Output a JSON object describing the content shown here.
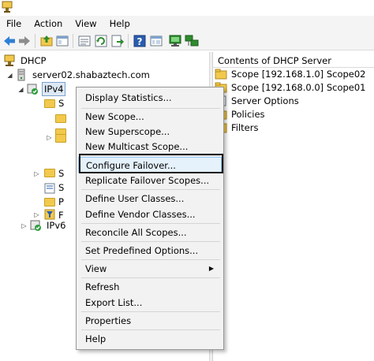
{
  "menubar": {
    "items": [
      "File",
      "Action",
      "View",
      "Help"
    ]
  },
  "toolbar": {
    "buttons": [
      "back-arrow-icon",
      "forward-arrow-icon",
      "up-folder-icon",
      "show-hide-tree-icon",
      "properties-icon",
      "refresh-icon",
      "export-icon",
      "help-icon",
      "view-icon",
      "monitor-icon",
      "network-icon"
    ]
  },
  "tree": {
    "root": "DHCP",
    "server": "server02.shabaztech.com",
    "ipv4": "IPv4",
    "ipv6": "IPv6",
    "partial_s1": "S",
    "partial_s2": "S",
    "partial_s3": "S",
    "partial_p1": "P",
    "partial_f1": "F"
  },
  "right_pane": {
    "header": "Contents of DHCP Server",
    "items": [
      "Scope [192.168.1.0] Scope02",
      "Scope [192.168.0.0] Scope01",
      "Server Options",
      "Policies",
      "Filters"
    ]
  },
  "context_menu": {
    "display_statistics": "Display Statistics...",
    "new_scope": "New Scope...",
    "new_superscope": "New Superscope...",
    "new_multicast_scope": "New Multicast Scope...",
    "configure_failover": "Configure Failover...",
    "replicate_failover_scopes": "Replicate Failover Scopes...",
    "define_user_classes": "Define User Classes...",
    "define_vendor_classes": "Define Vendor Classes...",
    "reconcile_all_scopes": "Reconcile All Scopes...",
    "set_predefined_options": "Set Predefined Options...",
    "view": "View",
    "refresh": "Refresh",
    "export_list": "Export List...",
    "properties": "Properties",
    "help": "Help"
  },
  "colors": {
    "menu_bg": "#f2f2f2",
    "highlight_bg": "#e5f1fb",
    "highlight_border": "#90c8f6",
    "folder": "#f2c94c",
    "selection_bg": "#dde8f5"
  }
}
